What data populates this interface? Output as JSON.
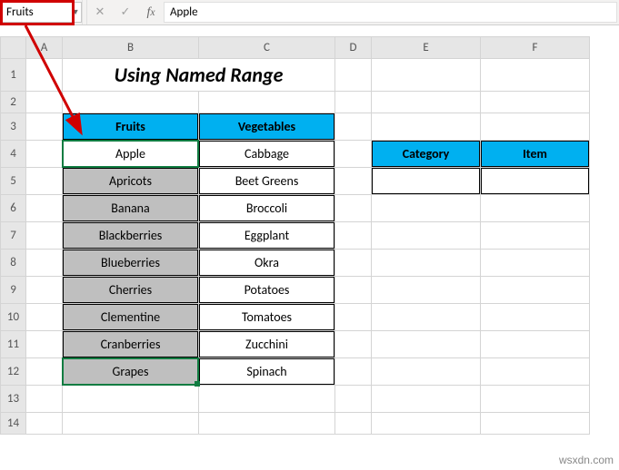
{
  "name_box": {
    "value": "Fruits"
  },
  "formula_bar": {
    "value": "Apple"
  },
  "columns": [
    "A",
    "B",
    "C",
    "D",
    "E",
    "F"
  ],
  "rows": [
    "1",
    "2",
    "3",
    "4",
    "5",
    "6",
    "7",
    "8",
    "9",
    "10",
    "11",
    "12",
    "13",
    "14"
  ],
  "title": "Using Named Range",
  "table1": {
    "headers": [
      "Fruits",
      "Vegetables"
    ],
    "rows": [
      [
        "Apple",
        "Cabbage"
      ],
      [
        "Apricots",
        "Beet Greens"
      ],
      [
        "Banana",
        "Broccoli"
      ],
      [
        "Blackberries",
        "Eggplant"
      ],
      [
        "Blueberries",
        "Okra"
      ],
      [
        "Cherries",
        "Potatoes"
      ],
      [
        "Clementine",
        "Tomatoes"
      ],
      [
        "Cranberries",
        "Zucchini"
      ],
      [
        "Grapes",
        "Spinach"
      ]
    ]
  },
  "table2": {
    "headers": [
      "Category",
      "Item"
    ]
  },
  "watermark": "wsxdn.com"
}
